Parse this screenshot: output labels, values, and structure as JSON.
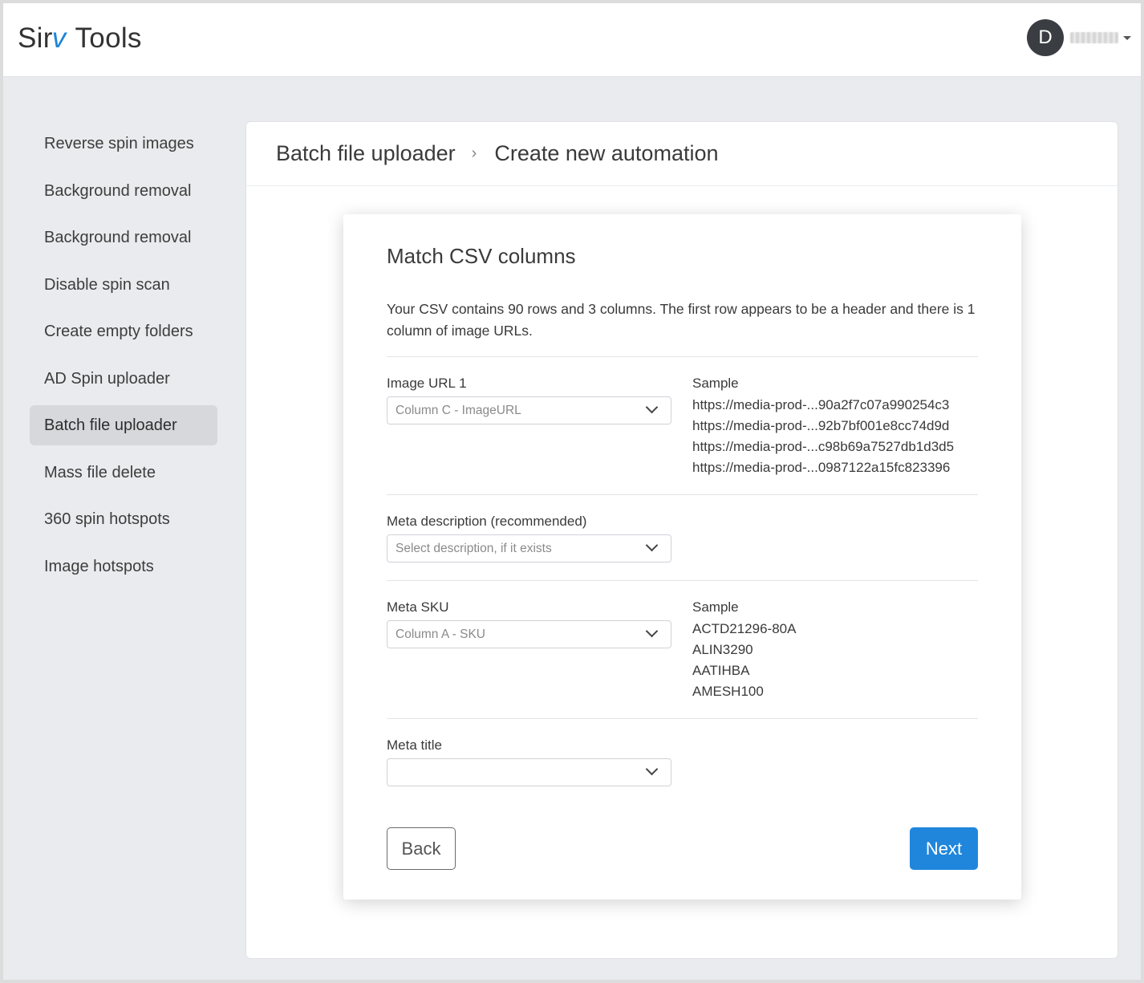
{
  "header": {
    "brand_part1": "Sir",
    "brand_accent": "v",
    "brand_part2": "Tools",
    "avatar_initial": "D"
  },
  "sidebar": {
    "items": [
      {
        "label": "Reverse spin images"
      },
      {
        "label": "Background removal"
      },
      {
        "label": "Background removal"
      },
      {
        "label": "Disable spin scan"
      },
      {
        "label": "Create empty folders"
      },
      {
        "label": "AD Spin uploader"
      },
      {
        "label": "Batch file uploader",
        "active": true
      },
      {
        "label": "Mass file delete"
      },
      {
        "label": "360 spin hotspots"
      },
      {
        "label": "Image hotspots"
      }
    ]
  },
  "breadcrumb": {
    "parent": "Batch file uploader",
    "separator": "›",
    "current": "Create new automation"
  },
  "card": {
    "title": "Match CSV columns",
    "intro": "Your CSV contains 90 rows and 3 columns. The first row appears to be a header and there is 1 column of image URLs.",
    "fields": [
      {
        "label": "Image URL 1",
        "select_value": "Column C - ImageURL",
        "sample_title": "Sample",
        "samples": [
          "https://media-prod-...90a2f7c07a990254c3",
          "https://media-prod-...92b7bf001e8cc74d9d",
          "https://media-prod-...c98b69a7527db1d3d5",
          "https://media-prod-...0987122a15fc823396"
        ]
      },
      {
        "label": "Meta description (recommended)",
        "select_value": "Select description, if it exists"
      },
      {
        "label": "Meta SKU",
        "select_value": "Column A - SKU",
        "sample_title": "Sample",
        "samples": [
          "ACTD21296-80A",
          "ALIN3290",
          "AATIHBA",
          "AMESH100"
        ]
      },
      {
        "label": "Meta title",
        "select_value": ""
      }
    ],
    "back_label": "Back",
    "next_label": "Next"
  }
}
